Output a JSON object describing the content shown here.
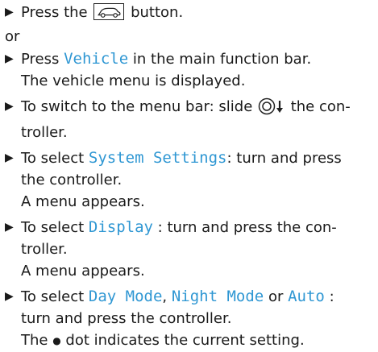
{
  "steps": [
    {
      "before": "Press the ",
      "after": " button."
    },
    {
      "or": "or"
    },
    {
      "before": "Press ",
      "ui": "Vehicle",
      "after": " in the main function bar.",
      "result": "The vehicle menu is displayed."
    },
    {
      "line1": "To switch to the menu bar: slide ",
      "line1_after": " the con-",
      "line2": "troller."
    },
    {
      "before": "To select ",
      "ui": "System Settings",
      "after": ": turn and press",
      "line2": "the controller.",
      "result": "A menu appears."
    },
    {
      "before": "To select ",
      "ui": "Display",
      "after": " : turn and press the con-",
      "line2": "troller.",
      "result": "A menu appears."
    },
    {
      "before": "To select ",
      "ui1": "Day Mode",
      "sep1": ", ",
      "ui2": "Night Mode",
      "sep2": " or ",
      "ui3": "Auto",
      "after": " :",
      "line2": "turn and press the controller.",
      "result_before": "The ",
      "result_dot": "●",
      "result_after": " dot indicates the current setting."
    }
  ],
  "bullet": "▶",
  "icons": {
    "vehicle_button": "car-button-icon",
    "controller_slide": "controller-slide-down-icon"
  },
  "colors": {
    "ui_text": "#2f97d3",
    "body_text": "#1a1a1a"
  }
}
